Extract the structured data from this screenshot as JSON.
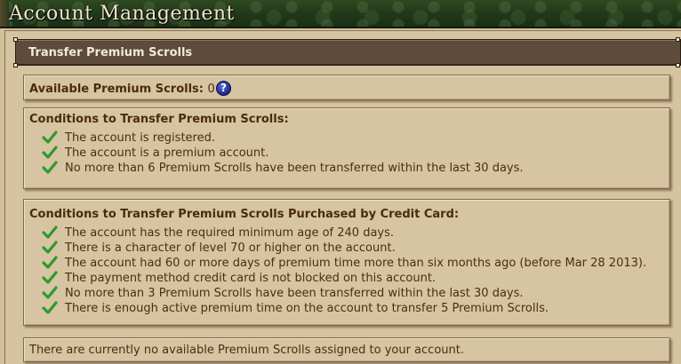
{
  "header": {
    "title": "Account Management"
  },
  "section": {
    "title": "Transfer Premium Scrolls"
  },
  "available": {
    "label": "Available Premium Scrolls:",
    "count": "0",
    "help_icon": "question-mark-icon"
  },
  "conditions": {
    "heading": "Conditions to Transfer Premium Scrolls:",
    "items": [
      {
        "icon": "checkmark-icon",
        "text": "The account is registered."
      },
      {
        "icon": "checkmark-icon",
        "text": "The account is a premium account."
      },
      {
        "icon": "checkmark-icon",
        "text": "No more than 6 Premium Scrolls have been transferred within the last 30 days."
      }
    ]
  },
  "cc_conditions": {
    "heading": "Conditions to Transfer Premium Scrolls Purchased by Credit Card:",
    "items": [
      {
        "icon": "checkmark-icon",
        "text": "The account has the required minimum age of 240 days."
      },
      {
        "icon": "checkmark-icon",
        "text": "There is a character of level 70 or higher on the account."
      },
      {
        "icon": "checkmark-icon",
        "text": "The account had 60 or more days of premium time more than six months ago (before Mar 28 2013)."
      },
      {
        "icon": "checkmark-icon",
        "text": "The payment method credit card is not blocked on this account."
      },
      {
        "icon": "checkmark-icon",
        "text": "No more than 3 Premium Scrolls have been transferred within the last 30 days."
      },
      {
        "icon": "checkmark-icon",
        "text": "There is enough active premium time on the account to transfer 5 Premium Scrolls."
      }
    ]
  },
  "footer": {
    "message": "There are currently no available Premium Scrolls assigned to your account."
  },
  "colors": {
    "header_green": "#223a1a",
    "section_bar": "#5e4b39",
    "parchment": "#d7c4a2",
    "check_green": "#2e9a2e",
    "help_blue": "#1a2a8a"
  }
}
